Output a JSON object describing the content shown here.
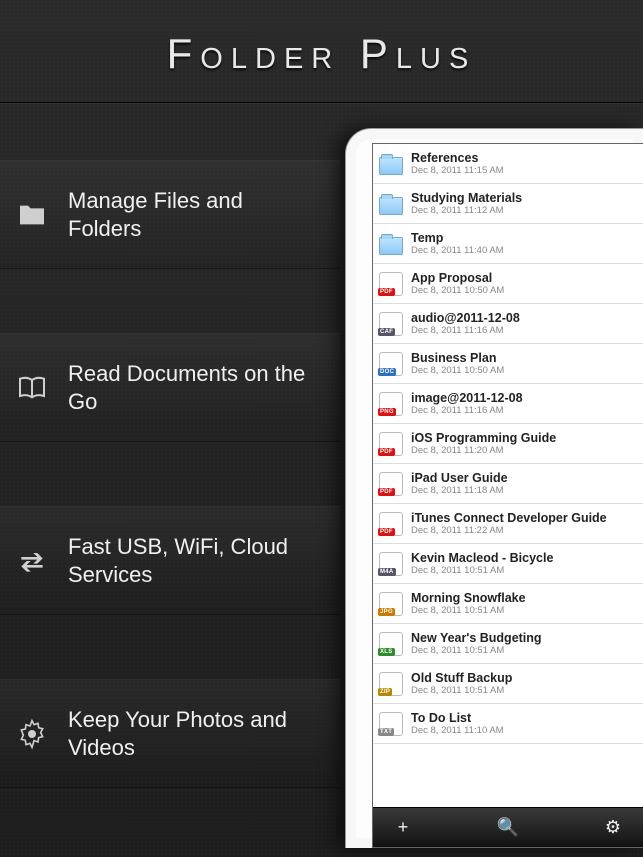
{
  "title": "Folder Plus",
  "features": [
    {
      "icon": "folder-icon",
      "label": "Manage Files and Folders"
    },
    {
      "icon": "book-icon",
      "label": "Read Documents on the Go"
    },
    {
      "icon": "transfer-icon",
      "label": "Fast USB, WiFi, Cloud Services"
    },
    {
      "icon": "gear-icon",
      "label": "Keep Your Photos and Videos"
    }
  ],
  "files": [
    {
      "type": "folder",
      "name": "References",
      "ts": "Dec 8, 2011 11:15 AM"
    },
    {
      "type": "folder",
      "name": "Studying Materials",
      "ts": "Dec 8, 2011 11:12 AM"
    },
    {
      "type": "folder",
      "name": "Temp",
      "ts": "Dec 8, 2011 11:40 AM"
    },
    {
      "type": "pdf",
      "name": "App Proposal",
      "ts": "Dec 8, 2011 10:50 AM"
    },
    {
      "type": "caf",
      "name": "audio@2011-12-08",
      "ts": "Dec 8, 2011 11:16 AM"
    },
    {
      "type": "doc",
      "name": "Business Plan",
      "ts": "Dec 8, 2011 10:50 AM"
    },
    {
      "type": "png",
      "name": "image@2011-12-08",
      "ts": "Dec 8, 2011 11:16 AM"
    },
    {
      "type": "pdf",
      "name": "iOS Programming Guide",
      "ts": "Dec 8, 2011 11:20 AM"
    },
    {
      "type": "pdf",
      "name": "iPad User Guide",
      "ts": "Dec 8, 2011 11:18 AM"
    },
    {
      "type": "pdf",
      "name": "iTunes Connect Developer Guide",
      "ts": "Dec 8, 2011 11:22 AM"
    },
    {
      "type": "m4a",
      "name": "Kevin Macleod - Bicycle",
      "ts": "Dec 8, 2011 10:51 AM"
    },
    {
      "type": "jpg",
      "name": "Morning Snowflake",
      "ts": "Dec 8, 2011 10:51 AM"
    },
    {
      "type": "xls",
      "name": "New Year's Budgeting",
      "ts": "Dec 8, 2011 10:51 AM"
    },
    {
      "type": "zip",
      "name": "Old Stuff Backup",
      "ts": "Dec 8, 2011 10:51 AM"
    },
    {
      "type": "txt",
      "name": "To Do List",
      "ts": "Dec 8, 2011 11:10 AM"
    }
  ],
  "file_badges": {
    "pdf": {
      "label": "PDF",
      "color": "#d11"
    },
    "caf": {
      "label": "CAF",
      "color": "#556"
    },
    "doc": {
      "label": "DOC",
      "color": "#2b6fc3"
    },
    "png": {
      "label": "PNG",
      "color": "#d11"
    },
    "m4a": {
      "label": "M4A",
      "color": "#556"
    },
    "jpg": {
      "label": "JPG",
      "color": "#cc7a00"
    },
    "xls": {
      "label": "XLS",
      "color": "#2e8b2e"
    },
    "zip": {
      "label": "ZIP",
      "color": "#b58900"
    },
    "txt": {
      "label": "TXT",
      "color": "#888"
    }
  },
  "toolbar": {
    "add": "+",
    "search": "🔍",
    "settings": "⚙"
  }
}
